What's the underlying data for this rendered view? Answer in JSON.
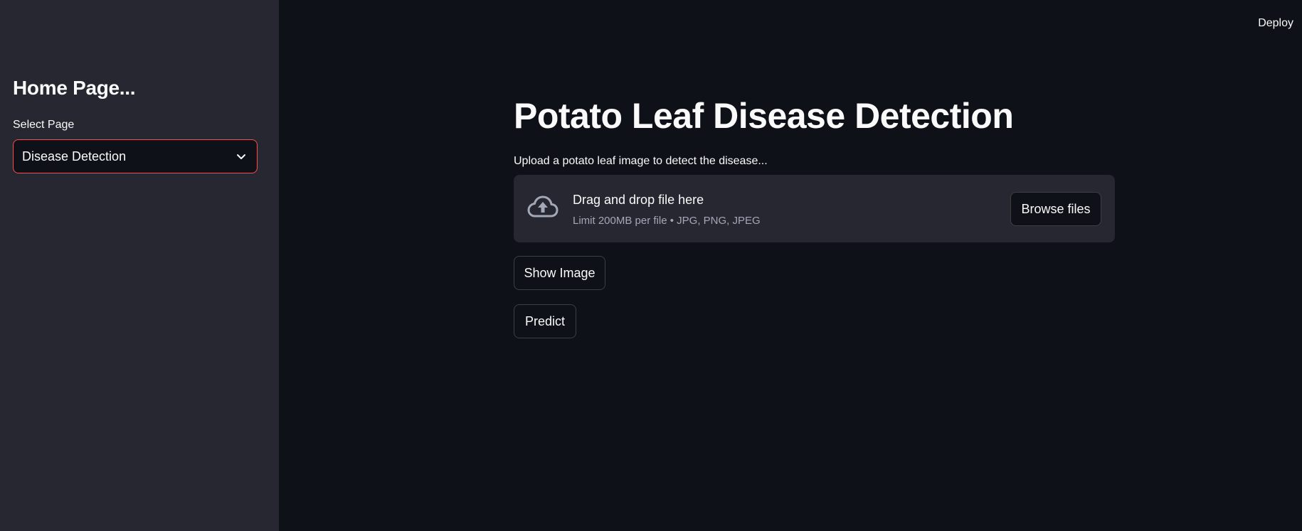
{
  "header": {
    "deploy_label": "Deploy"
  },
  "sidebar": {
    "title": "Home Page...",
    "select_label": "Select Page",
    "select_value": "Disease Detection",
    "chevron_icon": "chevron-down-icon"
  },
  "main": {
    "title": "Potato Leaf Disease Detection",
    "uploader": {
      "label": "Upload a potato leaf image to detect the disease...",
      "icon": "cloud-upload-icon",
      "drop_title": "Drag and drop file here",
      "drop_limit": "Limit 200MB per file • JPG, PNG, JPEG",
      "browse_label": "Browse files"
    },
    "show_image_label": "Show Image",
    "predict_label": "Predict"
  },
  "colors": {
    "background": "#0e1117",
    "sidebar": "#262730",
    "accent": "#ff4b4b",
    "text": "#fafafa",
    "muted_text": "#a3a8b8"
  }
}
